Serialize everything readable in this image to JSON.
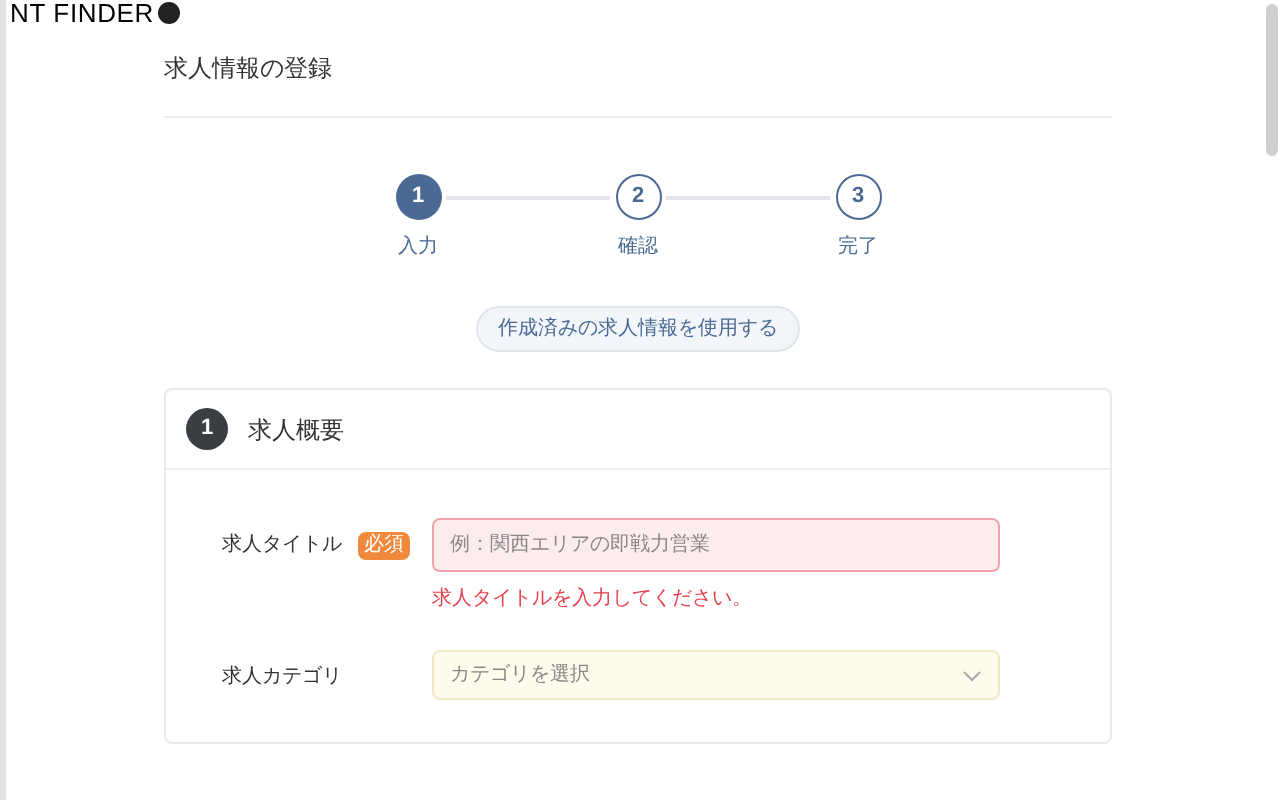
{
  "logo": {
    "text": "NT FINDER"
  },
  "page_title": "求人情報の登録",
  "steps": [
    {
      "number": "1",
      "label": "入力",
      "selected": true
    },
    {
      "number": "2",
      "label": "確認",
      "selected": false
    },
    {
      "number": "3",
      "label": "完了",
      "selected": false
    }
  ],
  "reuse_button": "作成済みの求人情報を使用する",
  "section": {
    "number": "1",
    "title": "求人概要",
    "fields": [
      {
        "kind": "text",
        "label": "求人タイトル",
        "badge": "必須",
        "placeholder": "例：関西エリアの即戦力営業",
        "invalid": true,
        "error": "求人タイトルを入力してください。"
      },
      {
        "kind": "select",
        "label": "求人カテゴリ",
        "placeholder": "カテゴリを選択",
        "invalid": false
      }
    ]
  }
}
